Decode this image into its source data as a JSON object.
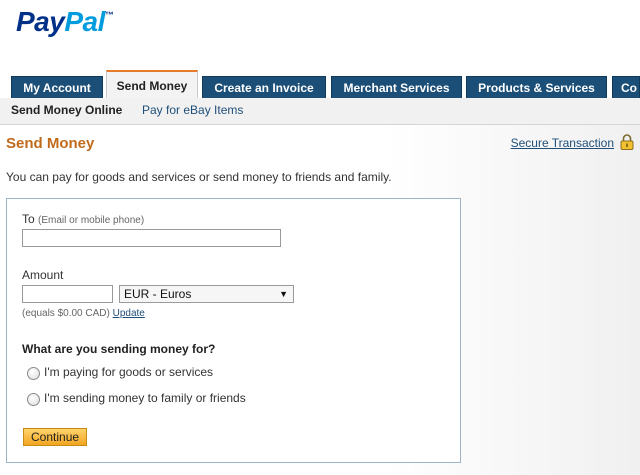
{
  "brand": {
    "logo_pay": "Pay",
    "logo_pal": "Pal",
    "logo_tm": "™"
  },
  "tabs": [
    {
      "label": "My Account",
      "active": false
    },
    {
      "label": "Send Money",
      "active": true
    },
    {
      "label": "Create an Invoice",
      "active": false
    },
    {
      "label": "Merchant Services",
      "active": false
    },
    {
      "label": "Products & Services",
      "active": false
    },
    {
      "label": "Co",
      "active": false
    }
  ],
  "subnav": [
    {
      "label": "Send Money Online",
      "active": true
    },
    {
      "label": "Pay for eBay Items",
      "active": false
    }
  ],
  "page": {
    "title": "Send Money",
    "secure_link": "Secure Transaction",
    "intro": "You can pay for goods and services or send money to friends and family."
  },
  "form": {
    "to_label": "To",
    "to_hint": "(Email or mobile phone)",
    "to_value": "",
    "amount_label": "Amount",
    "amount_value": "",
    "currency_selected": "EUR - Euros",
    "equals_text": "(equals $0.00 CAD)",
    "update_link": "Update",
    "question": "What are you sending money for?",
    "options": [
      {
        "label": "I'm paying for goods or services",
        "checked": false
      },
      {
        "label": "I'm sending money to family or friends",
        "checked": false
      }
    ],
    "continue_label": "Continue"
  },
  "colors": {
    "tab_bg": "#1c4f78",
    "title_orange": "#c06b1c",
    "link_blue": "#1f4e79"
  }
}
